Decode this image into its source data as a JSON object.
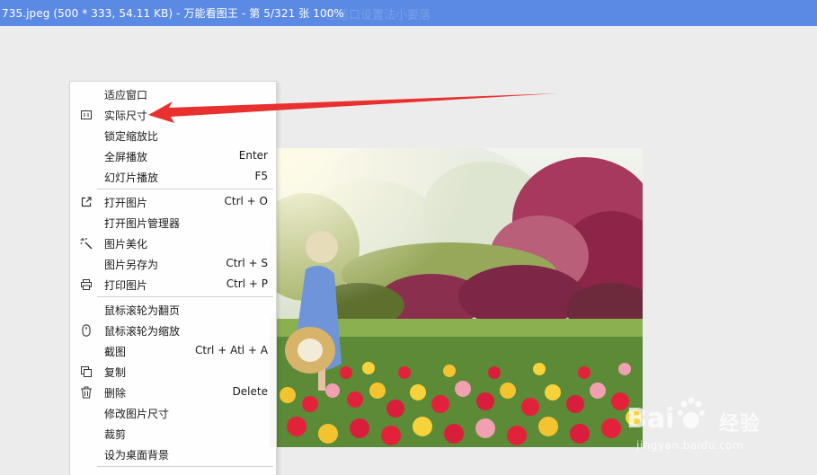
{
  "window": {
    "title": "735.jpeg (500 * 333, 54.11 KB) - 万能看图王 - 第 5/321 张 100%",
    "ghost_text": "在适口设置法小要落"
  },
  "context_menu": {
    "items": [
      {
        "label": "适应窗口",
        "shortcut": "",
        "icon": ""
      },
      {
        "label": "实际尺寸",
        "shortcut": "",
        "icon": "actual-size-icon"
      },
      {
        "label": "锁定缩放比",
        "shortcut": "",
        "icon": ""
      },
      {
        "label": "全屏播放",
        "shortcut": "Enter",
        "icon": ""
      },
      {
        "label": "幻灯片播放",
        "shortcut": "F5",
        "icon": ""
      },
      {
        "label": "打开图片",
        "shortcut": "Ctrl + O",
        "icon": "open-external-icon"
      },
      {
        "label": "打开图片管理器",
        "shortcut": "",
        "icon": ""
      },
      {
        "label": "图片美化",
        "shortcut": "",
        "icon": "magic-wand-icon"
      },
      {
        "label": "图片另存为",
        "shortcut": "Ctrl + S",
        "icon": ""
      },
      {
        "label": "打印图片",
        "shortcut": "Ctrl + P",
        "icon": "printer-icon"
      },
      {
        "label": "鼠标滚轮为翻页",
        "shortcut": "",
        "icon": ""
      },
      {
        "label": "鼠标滚轮为缩放",
        "shortcut": "",
        "icon": "mouse-icon"
      },
      {
        "label": "截图",
        "shortcut": "Ctrl + Atl + A",
        "icon": ""
      },
      {
        "label": "复制",
        "shortcut": "",
        "icon": "copy-icon"
      },
      {
        "label": "删除",
        "shortcut": "Delete",
        "icon": "trash-icon"
      },
      {
        "label": "修改图片尺寸",
        "shortcut": "",
        "icon": ""
      },
      {
        "label": "裁剪",
        "shortcut": "",
        "icon": ""
      },
      {
        "label": "设为桌面背景",
        "shortcut": "",
        "icon": ""
      }
    ]
  },
  "watermark": {
    "brand": "经验",
    "url": "jingyan.baidu.com"
  },
  "colors": {
    "titlebar": "#5b8ae4",
    "arrow": "#e8312f",
    "canvas": "#ececec"
  }
}
